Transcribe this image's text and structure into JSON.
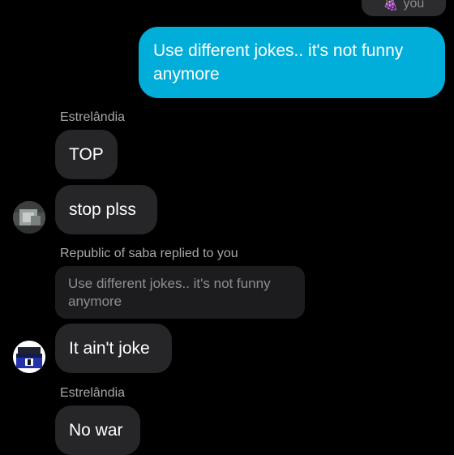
{
  "top_partial": {
    "emoji": "🍇",
    "text": "you"
  },
  "messages": {
    "outgoing_1": "Use different jokes.. it's not funny anymore",
    "sender_1": "Estrelândia",
    "incoming_1": "TOP",
    "incoming_2": "stop plss",
    "reply_label": "Republic of saba replied to you",
    "reply_quote": "Use different jokes.. it's not funny anymore",
    "incoming_3": "It ain't joke",
    "sender_2": "Estrelândia",
    "incoming_4": "No war"
  },
  "colors": {
    "outgoing_bubble": "#01aed9",
    "incoming_bubble": "#262628",
    "background": "#000000"
  }
}
